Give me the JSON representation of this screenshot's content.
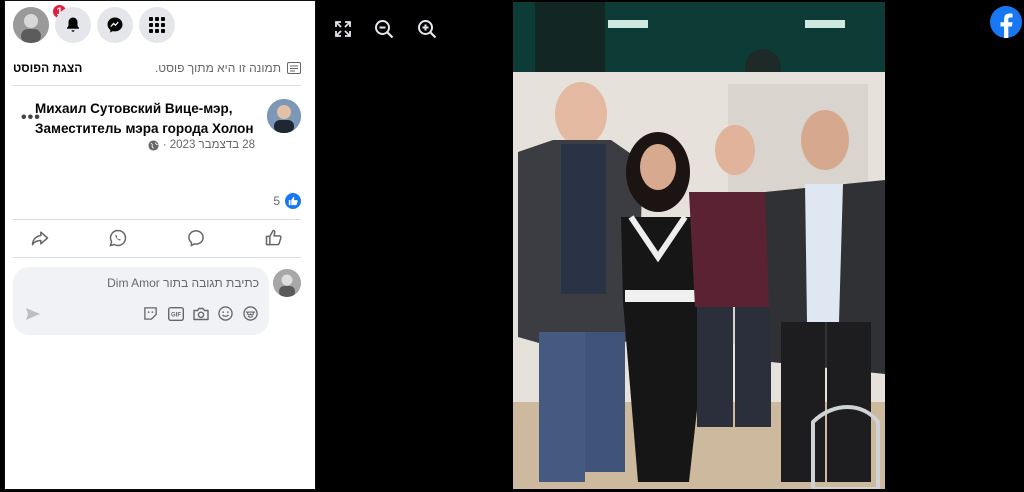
{
  "notifications": {
    "count": "1"
  },
  "post": {
    "section_title": "הצגת הפוסט",
    "section_note": "תמונה זו היא מתוך פוסט.",
    "author_name": "Михаил Сутовский Вице-мэр, Заместитель мэра города Холон",
    "date": "28 בדצמבר 2023 ·",
    "reaction_count": "5",
    "more": "•••"
  },
  "comment": {
    "placeholder": "כתיבת תגובה בתור Dim Amor"
  },
  "icons": {
    "bell": "bell-icon",
    "messenger": "messenger-icon",
    "menu": "menu-grid-icon",
    "expand": "expand-icon",
    "zoom_out": "zoom-out-icon",
    "zoom_in": "zoom-in-icon",
    "facebook": "facebook-logo-icon"
  },
  "colors": {
    "accent": "#1877f2",
    "badge": "#e41e3f"
  }
}
